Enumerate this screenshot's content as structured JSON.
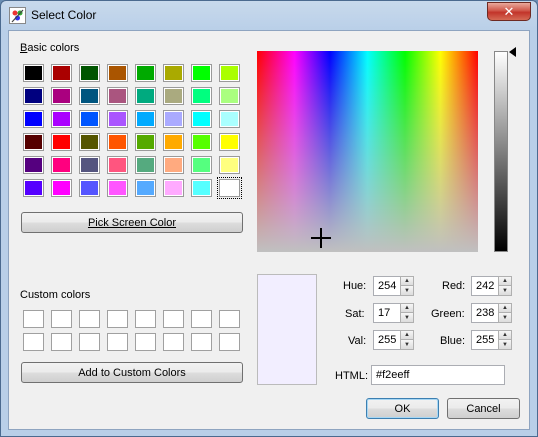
{
  "window": {
    "title": "Select Color"
  },
  "basic": {
    "label": "Basic colors",
    "underline_char": "B",
    "colors": [
      [
        "#000000",
        "#aa0000",
        "#005500",
        "#aa5500",
        "#00aa00",
        "#aaaa00",
        "#00ff00",
        "#aaff00"
      ],
      [
        "#00007f",
        "#aa007f",
        "#00557f",
        "#aa557f",
        "#00aa7f",
        "#aaaa7f",
        "#00ff7f",
        "#aaff7f"
      ],
      [
        "#0000ff",
        "#aa00ff",
        "#0055ff",
        "#aa55ff",
        "#00aaff",
        "#aaaaff",
        "#00ffff",
        "#aaffff"
      ],
      [
        "#550000",
        "#ff0000",
        "#555500",
        "#ff5500",
        "#55aa00",
        "#ffaa00",
        "#55ff00",
        "#ffff00"
      ],
      [
        "#55007f",
        "#ff007f",
        "#55557f",
        "#ff557f",
        "#55aa7f",
        "#ffaa7f",
        "#55ff7f",
        "#ffff7f"
      ],
      [
        "#5500ff",
        "#ff00ff",
        "#5555ff",
        "#ff55ff",
        "#55aaff",
        "#ffaaff",
        "#55ffff",
        "#ffffff"
      ]
    ]
  },
  "pick_screen": "Pick Screen Color",
  "custom": {
    "label": "Custom colors",
    "rows": 2,
    "cols": 8
  },
  "add_custom": "Add to Custom Colors",
  "fields": {
    "hue": {
      "label": "Hue:",
      "value": "254"
    },
    "sat": {
      "label": "Sat:",
      "value": "17"
    },
    "val": {
      "label": "Val:",
      "value": "255"
    },
    "red": {
      "label": "Red:",
      "value": "242"
    },
    "green": {
      "label": "Green:",
      "value": "238"
    },
    "blue": {
      "label": "Blue:",
      "value": "255"
    },
    "html": {
      "label": "HTML:",
      "value": "#f2eeff"
    }
  },
  "preview_color": "#f2eeff",
  "ok": "OK",
  "cancel": "Cancel"
}
